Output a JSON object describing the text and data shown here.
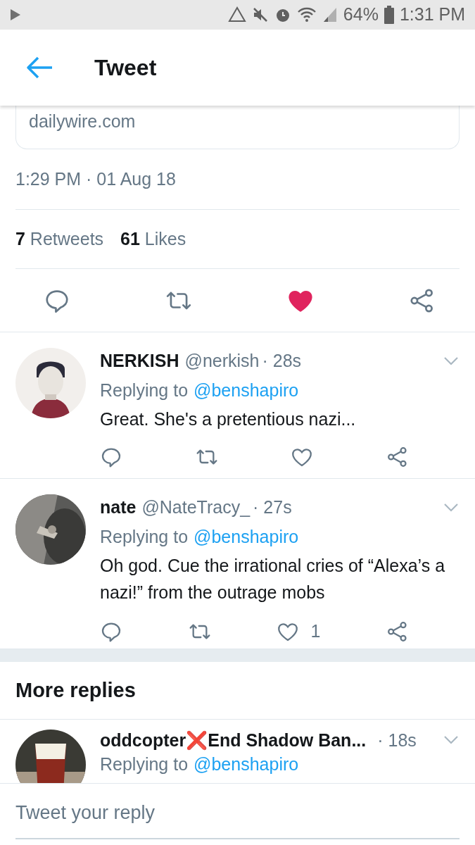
{
  "status_bar": {
    "battery": "64%",
    "time": "1:31 PM"
  },
  "header": {
    "title": "Tweet"
  },
  "link_card": {
    "domain": "dailywire.com"
  },
  "tweet": {
    "timestamp": "1:29 PM · 01 Aug 18",
    "retweets": {
      "count": "7",
      "label": "Retweets"
    },
    "likes": {
      "count": "61",
      "label": "Likes"
    },
    "liked": true
  },
  "replies": [
    {
      "name": "NERKISH",
      "handle": "@nerkish",
      "time": "· 28s",
      "replying_label": "Replying to",
      "replying_to": "@benshapiro",
      "text": "Great.  She's a pretentious nazi...",
      "liked": false
    },
    {
      "name": "nate",
      "handle": "@NateTracy_",
      "time": "· 27s",
      "replying_label": "Replying to",
      "replying_to": "@benshapiro",
      "text": "Oh god. Cue the irrational cries of “Alexa’s a nazi!” from the outrage mobs",
      "liked": false,
      "like_count": "1"
    }
  ],
  "more_replies": {
    "title": "More replies",
    "replies": [
      {
        "name": "oddcopter❌End Shadow Ban...",
        "time": "· 18s",
        "replying_label": "Replying to",
        "replying_to": "@benshapiro"
      }
    ]
  },
  "composer": {
    "placeholder": "Tweet your reply"
  }
}
